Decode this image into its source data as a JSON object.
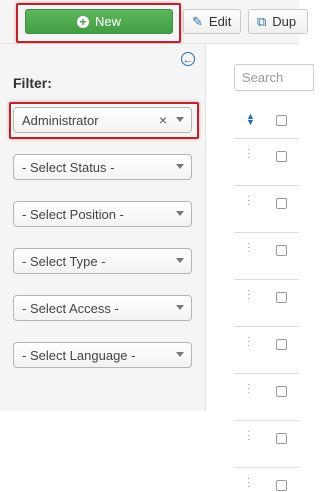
{
  "toolbar": {
    "new_label": "New",
    "edit_label": "Edit",
    "duplicate_label": "Dup"
  },
  "sidebar": {
    "filter_label": "Filter:",
    "filters": [
      {
        "label": "Administrator",
        "clearable": true
      },
      {
        "label": "- Select Status -"
      },
      {
        "label": "- Select Position -"
      },
      {
        "label": "- Select Type -"
      },
      {
        "label": "- Select Access -"
      },
      {
        "label": "- Select Language -"
      }
    ]
  },
  "list": {
    "search_placeholder": "Search",
    "rows": 8
  },
  "colors": {
    "new_button": "#5cb85c",
    "highlight": "#b7262b",
    "link_blue": "#2a6ea8"
  }
}
